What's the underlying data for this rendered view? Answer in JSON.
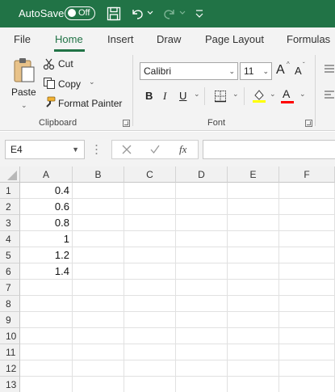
{
  "titlebar": {
    "autosave_label": "AutoSave",
    "toggle_label": "Off"
  },
  "tabs": [
    {
      "label": "File"
    },
    {
      "label": "Home"
    },
    {
      "label": "Insert"
    },
    {
      "label": "Draw"
    },
    {
      "label": "Page Layout"
    },
    {
      "label": "Formulas"
    }
  ],
  "ribbon": {
    "clipboard": {
      "paste_label": "Paste",
      "cut_label": "Cut",
      "copy_label": "Copy",
      "format_painter_label": "Format Painter",
      "group_label": "Clipboard"
    },
    "font": {
      "font_name": "Calibri",
      "font_size": "11",
      "group_label": "Font",
      "bold": "B",
      "italic": "I",
      "underline": "U",
      "increase_size": "A",
      "decrease_size": "A",
      "font_color": "A",
      "highlight_color": "#ffff00",
      "font_color_value": "#ff0000"
    }
  },
  "formula_bar": {
    "name_box": "E4",
    "fx_label": "fx",
    "formula": ""
  },
  "grid": {
    "columns": [
      "A",
      "B",
      "C",
      "D",
      "E",
      "F"
    ],
    "rows": [
      "1",
      "2",
      "3",
      "4",
      "5",
      "6",
      "7",
      "8",
      "9",
      "10",
      "11",
      "12",
      "13"
    ],
    "cells": [
      [
        "0.4",
        "",
        "",
        "",
        "",
        ""
      ],
      [
        "0.6",
        "",
        "",
        "",
        "",
        ""
      ],
      [
        "0.8",
        "",
        "",
        "",
        "",
        ""
      ],
      [
        "1",
        "",
        "",
        "",
        "",
        ""
      ],
      [
        "1.2",
        "",
        "",
        "",
        "",
        ""
      ],
      [
        "1.4",
        "",
        "",
        "",
        "",
        ""
      ],
      [
        "",
        "",
        "",
        "",
        "",
        ""
      ],
      [
        "",
        "",
        "",
        "",
        "",
        ""
      ],
      [
        "",
        "",
        "",
        "",
        "",
        ""
      ],
      [
        "",
        "",
        "",
        "",
        "",
        ""
      ],
      [
        "",
        "",
        "",
        "",
        "",
        ""
      ],
      [
        "",
        "",
        "",
        "",
        "",
        ""
      ],
      [
        "",
        "",
        "",
        "",
        "",
        ""
      ]
    ]
  },
  "colors": {
    "accent": "#217346",
    "ribbon_bg": "#f3f3f3"
  }
}
